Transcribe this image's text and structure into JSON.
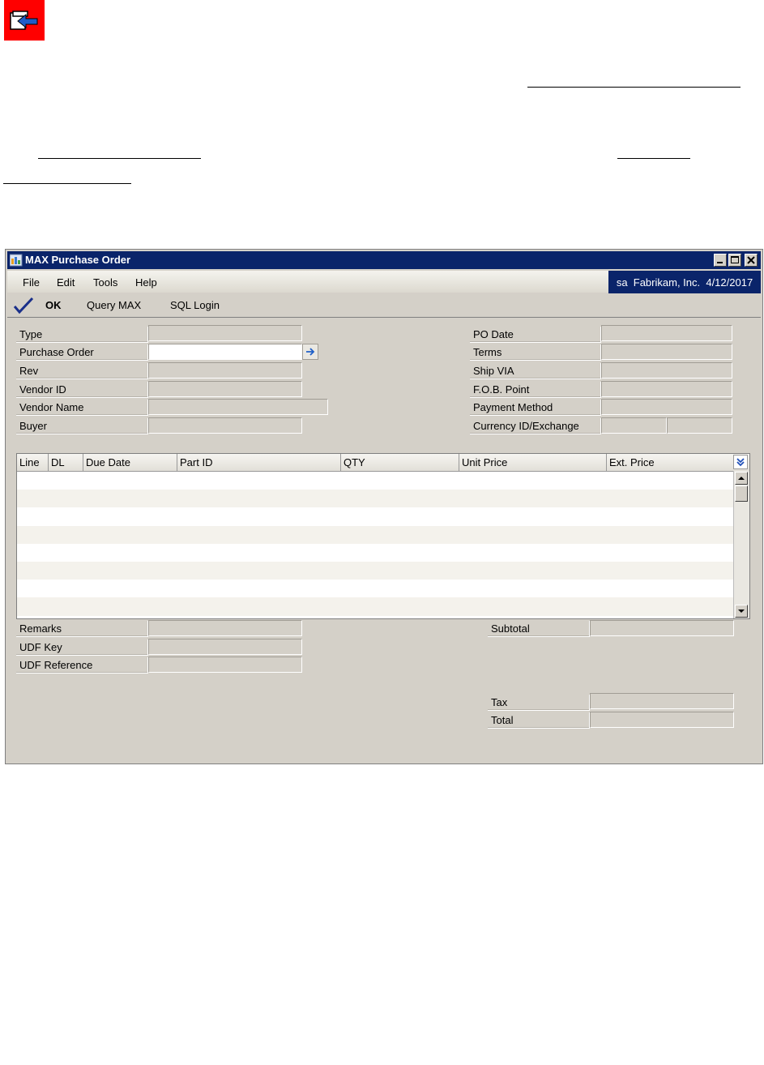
{
  "window": {
    "title": "MAX Purchase Order",
    "company_info": "sa  Fabrikam, Inc.  4/12/2017"
  },
  "menu": {
    "items": [
      "File",
      "Edit",
      "Tools",
      "Help"
    ]
  },
  "toolbar": {
    "ok_label": "OK",
    "query_label": "Query MAX",
    "sql_label": "SQL Login"
  },
  "header_left": {
    "labels": [
      "Type",
      "Purchase Order",
      "Rev",
      "Vendor ID",
      "Vendor Name",
      "Buyer"
    ],
    "values": [
      "",
      "",
      "",
      "",
      "",
      ""
    ]
  },
  "header_right": {
    "labels": [
      "PO Date",
      "Terms",
      "Ship VIA",
      "F.O.B. Point",
      "Payment Method",
      "Currency ID/Exchange"
    ],
    "values": [
      "",
      "",
      "",
      "",
      "",
      "",
      ""
    ]
  },
  "grid": {
    "columns": [
      "Line",
      "DL",
      "Due Date",
      "Part ID",
      "QTY",
      "Unit Price",
      "Ext. Price"
    ]
  },
  "footer_left": {
    "labels": [
      "Remarks",
      "UDF Key",
      "UDF Reference"
    ],
    "values": [
      "",
      "",
      ""
    ]
  },
  "totals": {
    "subtotal_label": "Subtotal",
    "tax_label": "Tax",
    "total_label": "Total",
    "subtotal": "",
    "tax": "",
    "total": ""
  },
  "colors": {
    "title_bar": "#0a246a",
    "window_bg": "#d4d0c8",
    "doc_icon_bg": "#ff0000"
  },
  "icons": [
    "back-arrow-icon",
    "app-window-icon",
    "minimize-icon",
    "maximize-icon",
    "close-icon",
    "checkmark-icon",
    "lookup-arrow-icon",
    "expand-down-icon",
    "scroll-up-icon",
    "scroll-down-icon"
  ]
}
